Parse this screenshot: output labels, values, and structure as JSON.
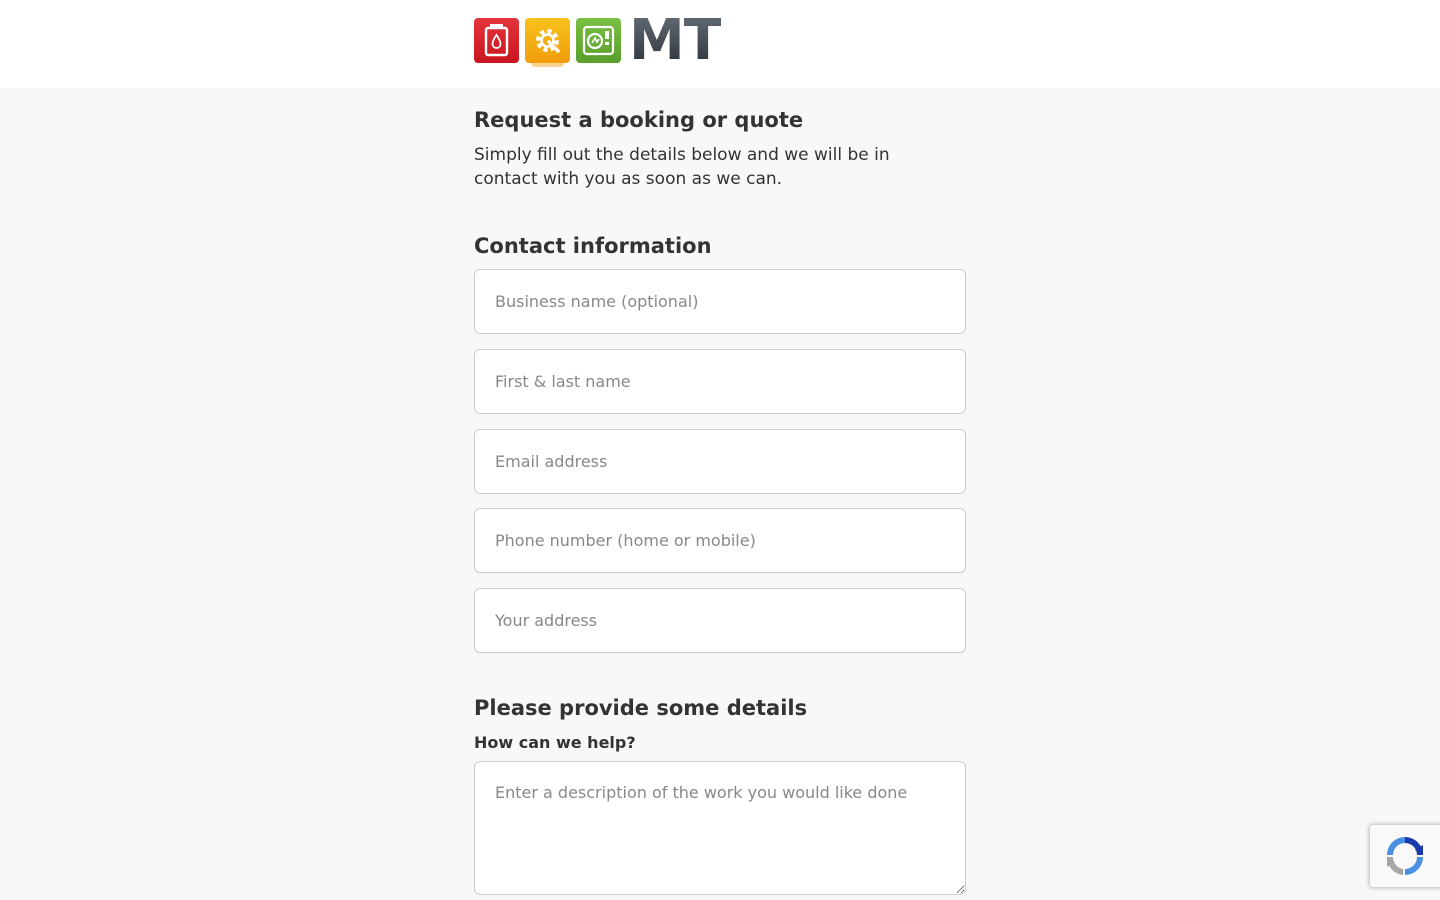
{
  "header": {
    "logo": {
      "tiles": [
        {
          "icon": "fire-extinguisher-icon",
          "color": "#d82029"
        },
        {
          "icon": "gear-wrench-icon",
          "color": "#f4ad15"
        },
        {
          "icon": "electrical-test-icon",
          "color": "#6cb13a"
        }
      ],
      "wordmark": "MT"
    }
  },
  "main": {
    "title": "Request a booking or quote",
    "intro": "Simply fill out the details below and we will be in contact with you as soon as we can.",
    "contact": {
      "heading": "Contact information",
      "fields": [
        {
          "placeholder": "Business name (optional)",
          "value": ""
        },
        {
          "placeholder": "First & last name",
          "value": ""
        },
        {
          "placeholder": "Email address",
          "value": ""
        },
        {
          "placeholder": "Phone number (home or mobile)",
          "value": ""
        },
        {
          "placeholder": "Your address",
          "value": ""
        }
      ]
    },
    "details": {
      "heading": "Please provide some details",
      "help_label": "How can we help?",
      "description_placeholder": "Enter a description of the work you would like done",
      "description_value": ""
    }
  },
  "recaptcha": {
    "icon": "recaptcha-icon"
  },
  "colors": {
    "background": "#f8f8f8",
    "header_background": "#ffffff",
    "text": "#333333",
    "placeholder": "#888888",
    "field_border": "#cccccc"
  }
}
